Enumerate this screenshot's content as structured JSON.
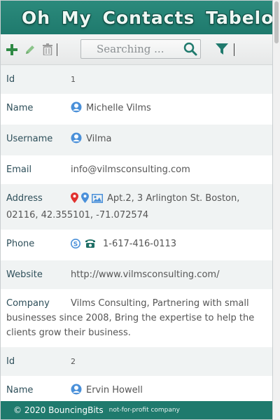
{
  "header": {
    "title": "Oh My Contacts Tabelo"
  },
  "toolbar": {
    "search_placeholder": "Searching ..."
  },
  "colors": {
    "brand": "#1f7a6d",
    "accent_green": "#2f8a45",
    "icon_blue": "#4a90d9",
    "icon_red": "#e0322f"
  },
  "records": [
    {
      "id_label": "Id",
      "id": "1",
      "name_label": "Name",
      "name": "Michelle Vilms",
      "username_label": "Username",
      "username": "Vilma",
      "email_label": "Email",
      "email": "info@vilmsconsulting.com",
      "address_label": "Address",
      "address": "Apt.2, 3 Arlington St. Boston, 02116, 42.355101, -71.072574",
      "phone_label": "Phone",
      "phone": "1-617-416-0113",
      "website_label": "Website",
      "website": "http://www.vilmsconsulting.com/",
      "company_label": "Company",
      "company": "Vilms Consulting, Partnering with small businesses since 2008, Bring the expertise to help the clients grow their business."
    },
    {
      "id_label": "Id",
      "id": "2",
      "name_label": "Name",
      "name": "Ervin Howell"
    }
  ],
  "footer": {
    "copyright": "© 2020 BouncingBits",
    "tagline": "not-for-profit company"
  }
}
